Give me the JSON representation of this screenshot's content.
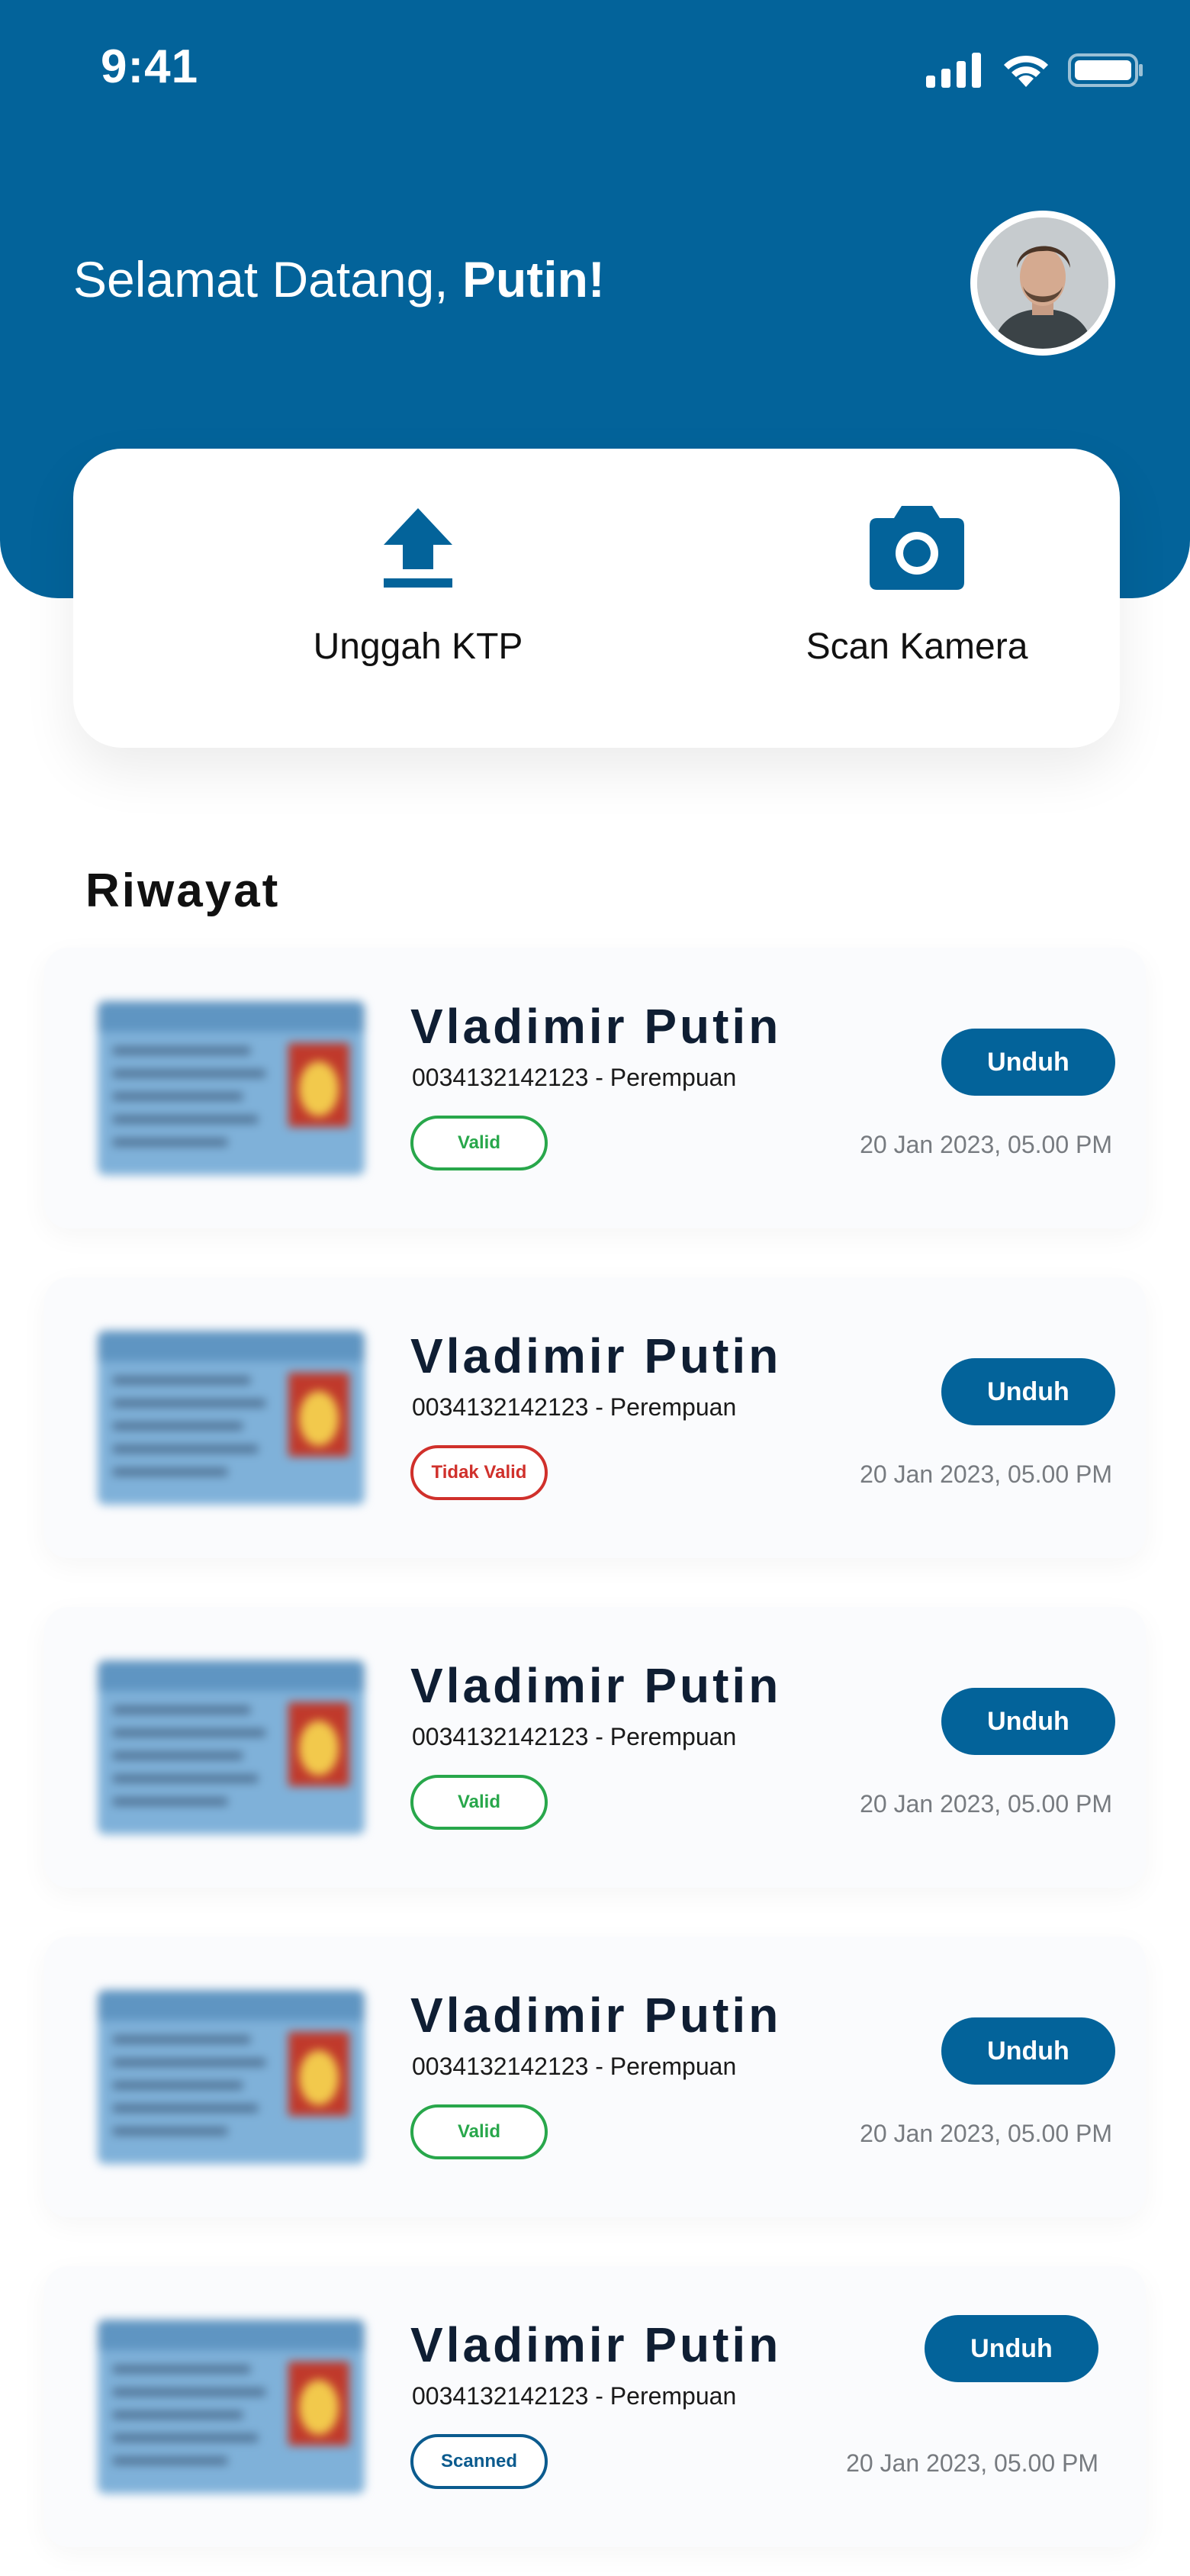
{
  "status_bar": {
    "time": "9:41"
  },
  "header": {
    "greeting_prefix": "Selamat Datang, ",
    "greeting_name": "Putin!",
    "bg_color": "#03639A"
  },
  "actions": [
    {
      "label": "Unggah KTP",
      "icon": "upload-icon"
    },
    {
      "label": "Scan Kamera",
      "icon": "camera-icon"
    }
  ],
  "history": {
    "title": "Riwayat",
    "items": [
      {
        "name": "Vladimir Putin",
        "id_line": "0034132142123 - Perempuan",
        "status": "Valid",
        "status_type": "valid",
        "button": "Unduh",
        "date": "20 Jan  2023, 05.00 PM"
      },
      {
        "name": "Vladimir Putin",
        "id_line": "0034132142123 - Perempuan",
        "status": "Tidak Valid",
        "status_type": "invalid",
        "button": "Unduh",
        "date": "20 Jan  2023, 05.00 PM"
      },
      {
        "name": "Vladimir Putin",
        "id_line": "0034132142123 - Perempuan",
        "status": "Valid",
        "status_type": "valid",
        "button": "Unduh",
        "date": "20 Jan  2023, 05.00 PM"
      },
      {
        "name": "Vladimir Putin",
        "id_line": "0034132142123 - Perempuan",
        "status": "Valid",
        "status_type": "valid",
        "button": "Unduh",
        "date": "20 Jan  2023, 05.00 PM"
      },
      {
        "name": "Vladimir Putin",
        "id_line": "0034132142123 - Perempuan",
        "status": "Scanned",
        "status_type": "scanned",
        "button": "Unduh",
        "date": "20 Jan  2023, 05.00 PM"
      }
    ]
  },
  "colors": {
    "valid": "#28A74B",
    "invalid": "#D0302B",
    "scanned": "#0B5B8E",
    "primary": "#03639A"
  }
}
